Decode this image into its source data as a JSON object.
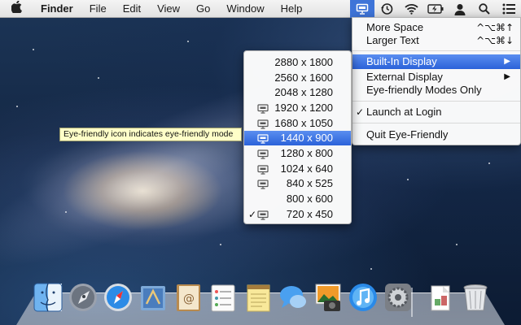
{
  "menubar": {
    "app_name": "Finder",
    "items": [
      "File",
      "Edit",
      "View",
      "Go",
      "Window",
      "Help"
    ]
  },
  "main_menu": {
    "more_space": "More Space",
    "more_space_shortcut": "^⌥⌘↑",
    "larger_text": "Larger Text",
    "larger_text_shortcut": "^⌥⌘↓",
    "builtin_display": "Built-In Display",
    "external_display": "External Display",
    "eye_friendly_only": "Eye-friendly Modes Only",
    "launch_at_login": "Launch at Login",
    "launch_at_login_checked": true,
    "quit": "Quit Eye-Friendly"
  },
  "resolutions": [
    {
      "label": "2880 x 1800",
      "eye_friendly": false,
      "selected": false,
      "checked": false
    },
    {
      "label": "2560 x 1600",
      "eye_friendly": false,
      "selected": false,
      "checked": false
    },
    {
      "label": "2048 x 1280",
      "eye_friendly": false,
      "selected": false,
      "checked": false
    },
    {
      "label": "1920 x 1200",
      "eye_friendly": true,
      "selected": false,
      "checked": false
    },
    {
      "label": "1680 x 1050",
      "eye_friendly": true,
      "selected": false,
      "checked": false
    },
    {
      "label": "1440 x 900",
      "eye_friendly": true,
      "selected": true,
      "checked": false
    },
    {
      "label": "1280 x 800",
      "eye_friendly": true,
      "selected": false,
      "checked": false
    },
    {
      "label": "1024 x 640",
      "eye_friendly": true,
      "selected": false,
      "checked": false
    },
    {
      "label": "840 x 525",
      "eye_friendly": true,
      "selected": false,
      "checked": false
    },
    {
      "label": "800 x 600",
      "eye_friendly": false,
      "selected": false,
      "checked": false
    },
    {
      "label": "720 x 450",
      "eye_friendly": true,
      "selected": false,
      "checked": true
    }
  ],
  "tooltip": "Eye-friendly icon indicates eye-friendly mode",
  "colors": {
    "highlight": "#2b62d9",
    "menubar": "#e8e8e8"
  }
}
